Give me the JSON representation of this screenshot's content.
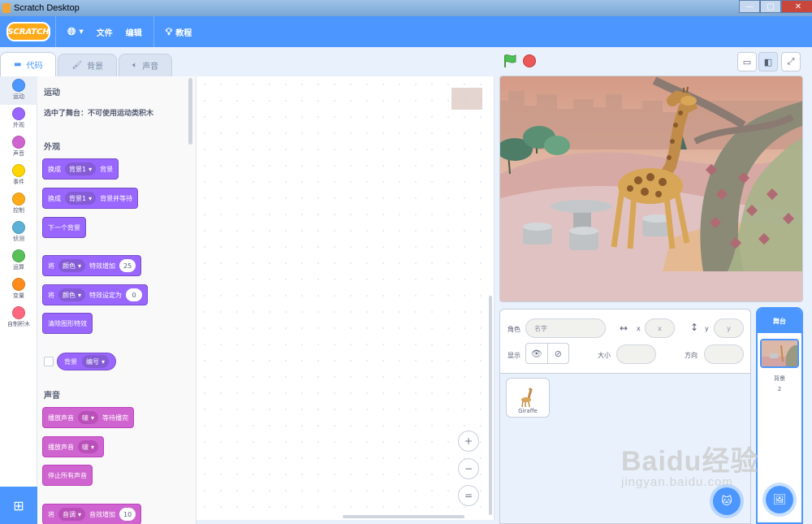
{
  "window": {
    "title": "Scratch Desktop"
  },
  "menubar": {
    "logo": "SCRATCH",
    "file": "文件",
    "edit": "编辑",
    "tutorials": "教程"
  },
  "tabs": [
    {
      "label": "代码"
    },
    {
      "label": "背景"
    },
    {
      "label": "声音"
    }
  ],
  "categories": [
    {
      "label": "运动",
      "color": "#4c97ff"
    },
    {
      "label": "外观",
      "color": "#9966ff"
    },
    {
      "label": "声音",
      "color": "#cf63cf"
    },
    {
      "label": "事件",
      "color": "#ffd500"
    },
    {
      "label": "控制",
      "color": "#ffab19"
    },
    {
      "label": "侦测",
      "color": "#5cb1d6"
    },
    {
      "label": "运算",
      "color": "#59c059"
    },
    {
      "label": "变量",
      "color": "#ff8c1a"
    },
    {
      "label": "自制积木",
      "color": "#ff6680"
    }
  ],
  "palette": {
    "motion_title": "运动",
    "motion_note": "选中了舞台：不可使用运动类积木",
    "looks_title": "外观",
    "switch_backdrop": {
      "pre": "换成",
      "value": "背景1",
      "post": "背景"
    },
    "switch_backdrop_wait": {
      "pre": "换成",
      "value": "背景1",
      "post": "背景并等待"
    },
    "next_backdrop": "下一个背景",
    "change_effect": {
      "pre": "将",
      "value": "颜色",
      "mid": "特效增加",
      "num": "25"
    },
    "set_effect": {
      "pre": "将",
      "value": "颜色",
      "mid": "特效设定为",
      "num": "0"
    },
    "clear_effects": "清除图形特效",
    "backdrop_reporter": {
      "label": "背景",
      "value": "编号"
    },
    "sound_title": "声音",
    "play_until_done": {
      "pre": "播放声音",
      "value": "啵",
      "post": "等待播完"
    },
    "start_sound": {
      "pre": "播放声音",
      "value": "啵"
    },
    "stop_all_sounds": "停止所有声音",
    "change_sound_effect": {
      "pre": "将",
      "value": "音调",
      "mid": "音效增加",
      "num": "10"
    }
  },
  "zoom": {
    "in": "+",
    "out": "−",
    "reset": "="
  },
  "sprite_info": {
    "sprite_label": "角色",
    "name_placeholder": "名字",
    "x_label": "x",
    "x_placeholder": "x",
    "y_label": "y",
    "y_placeholder": "y",
    "show_label": "显示",
    "size_label": "大小",
    "direction_label": "方向"
  },
  "sprites": [
    {
      "name": "Giraffe"
    }
  ],
  "stage_panel": {
    "title": "舞台",
    "backdrops_label": "背景",
    "backdrops_count": "2"
  },
  "watermark": {
    "brand": "Baidu经验",
    "url": "jingyan.baidu.com"
  }
}
